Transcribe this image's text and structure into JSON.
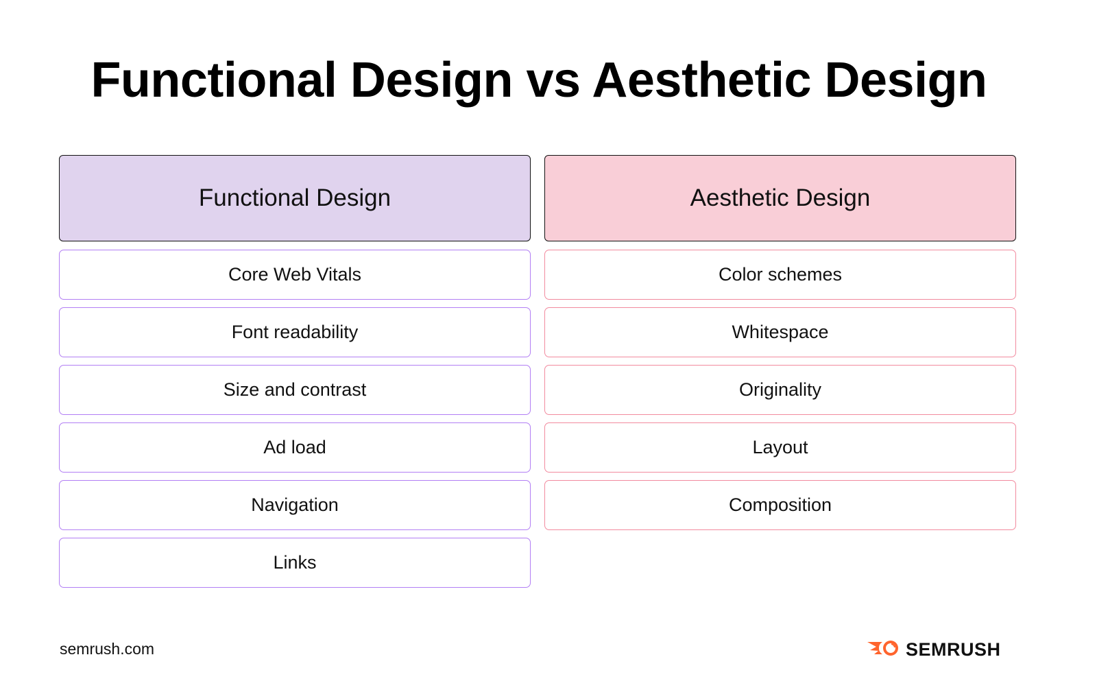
{
  "title": "Functional Design vs Aesthetic Design",
  "columns": [
    {
      "header": "Functional Design",
      "header_color": "#e0d3ee",
      "border_color": "#b27ef4",
      "items": [
        "Core Web Vitals",
        "Font readability",
        "Size and contrast",
        "Ad load",
        "Navigation",
        "Links"
      ]
    },
    {
      "header": "Aesthetic Design",
      "header_color": "#f9ced7",
      "border_color": "#f28a9e",
      "items": [
        "Color schemes",
        "Whitespace",
        "Originality",
        "Layout",
        "Composition"
      ]
    }
  ],
  "footer": {
    "site": "semrush.com",
    "brand": "SEMRUSH",
    "brand_icon": "semrush-fireball-icon",
    "brand_color": "#ff642d"
  }
}
